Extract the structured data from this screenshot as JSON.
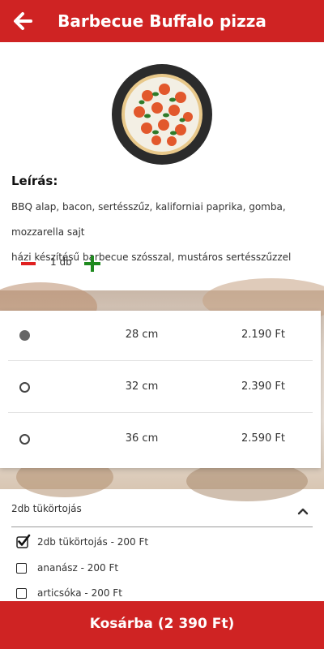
{
  "header": {
    "title": "Barbecue Buffalo pizza",
    "back_icon": "arrow-left-icon",
    "bg_color": "#cf2323"
  },
  "product": {
    "image_icon": "pizza-image",
    "description_label": "Leírás:",
    "description_line1": "BBQ alap, bacon, sertésszűz, kaliforniai paprika, gomba, mozzarella sajt",
    "description_line2": "házi készítésű barbecue szósszal, mustáros sertésszűzzel"
  },
  "quantity": {
    "minus_icon": "minus-icon",
    "value": "1 db",
    "plus_icon": "plus-icon"
  },
  "sizes": [
    {
      "size": "28 cm",
      "price": "2.190 Ft",
      "selected": true
    },
    {
      "size": "32 cm",
      "price": "2.390 Ft",
      "selected": false
    },
    {
      "size": "36 cm",
      "price": "2.590 Ft",
      "selected": false
    }
  ],
  "extras": {
    "header": "2db tükörtojás",
    "chevron_icon": "chevron-up-icon",
    "options": [
      {
        "label": "2db tükörtojás - 200 Ft",
        "checked": true
      },
      {
        "label": "ananász - 200 Ft",
        "checked": false
      },
      {
        "label": "articsóka - 200 Ft",
        "checked": false
      }
    ]
  },
  "cart": {
    "label": "Kosárba (2 390 Ft)"
  },
  "colors": {
    "accent": "#cf2323",
    "minus": "#e02020",
    "plus": "#1e8a1e"
  }
}
